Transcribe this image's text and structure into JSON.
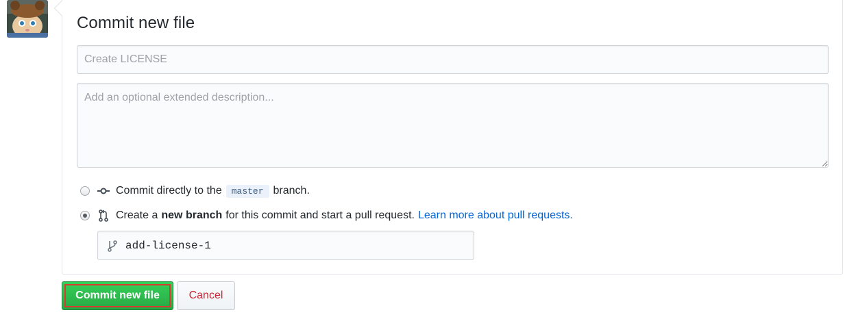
{
  "commit": {
    "heading": "Commit new file",
    "summary_placeholder": "Create LICENSE",
    "summary_value": "",
    "description_placeholder": "Add an optional extended description...",
    "description_value": ""
  },
  "options": {
    "direct": {
      "selected": false,
      "text_before": "Commit directly to the",
      "branch_name": "master",
      "text_after": "branch.",
      "icon": "git-commit-icon"
    },
    "new_branch": {
      "selected": true,
      "text_before": "Create a",
      "bold_text": "new branch",
      "text_after": "for this commit and start a pull request.",
      "link_text": "Learn more about pull requests.",
      "icon": "git-pull-request-icon"
    }
  },
  "branch_input": {
    "value": "add-license-1",
    "icon": "git-branch-icon"
  },
  "buttons": {
    "commit_label": "Commit new file",
    "cancel_label": "Cancel"
  },
  "colors": {
    "primary_green": "#28a745",
    "link_blue": "#0366d6",
    "cancel_red": "#cb2431",
    "highlight_border": "#d73a2f"
  }
}
